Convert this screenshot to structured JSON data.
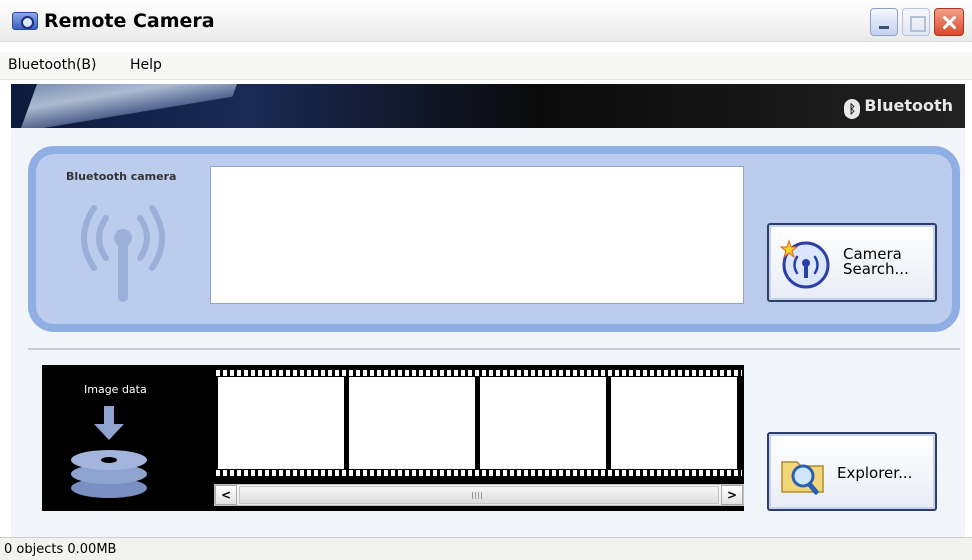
{
  "window": {
    "title": "Remote Camera",
    "icon": "camera-app-icon"
  },
  "menu": {
    "items": [
      {
        "label": "Bluetooth(B)"
      },
      {
        "label": "Help"
      }
    ]
  },
  "banner": {
    "logo_text": "Bluetooth"
  },
  "camera_panel": {
    "label": "Bluetooth camera",
    "search_button_label": "Camera Search..."
  },
  "image_panel": {
    "label": "Image data",
    "explorer_button_label": "Explorer..."
  },
  "status": {
    "text": "0 objects 0.00MB"
  },
  "colors": {
    "panel_fill": "#bccced",
    "panel_border": "#8eaee4",
    "banner_dark": "#0a0a0a"
  }
}
